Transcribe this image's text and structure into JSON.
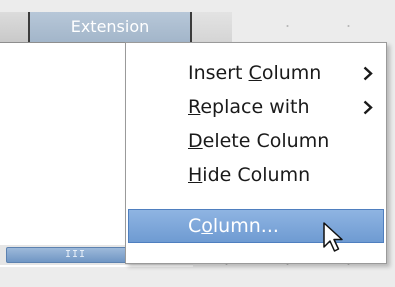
{
  "table": {
    "columns": [
      {
        "label": ""
      },
      {
        "label": "Extension"
      }
    ]
  },
  "scrollbar": {
    "grip": "III"
  },
  "context_menu": {
    "items": [
      {
        "pre": "Insert ",
        "key": "C",
        "post": "olumn",
        "has_submenu": true,
        "highlighted": false
      },
      {
        "pre": "",
        "key": "R",
        "post": "eplace with",
        "has_submenu": true,
        "highlighted": false
      },
      {
        "pre": "",
        "key": "D",
        "post": "elete Column",
        "has_submenu": false,
        "highlighted": false
      },
      {
        "pre": "",
        "key": "H",
        "post": "ide Column",
        "has_submenu": false,
        "highlighted": false
      },
      {
        "pre": "C",
        "key": "o",
        "post": "lumn...",
        "has_submenu": false,
        "highlighted": true
      }
    ]
  },
  "icons": {
    "submenu": "chevron-right-icon",
    "scroll_right": "chevron-right-icon",
    "cursor": "mouse-pointer-icon"
  },
  "colors": {
    "highlight": "#7aa3d6",
    "column_header_selected": "#aebfd2",
    "scroll_thumb": "#86a8d2"
  }
}
